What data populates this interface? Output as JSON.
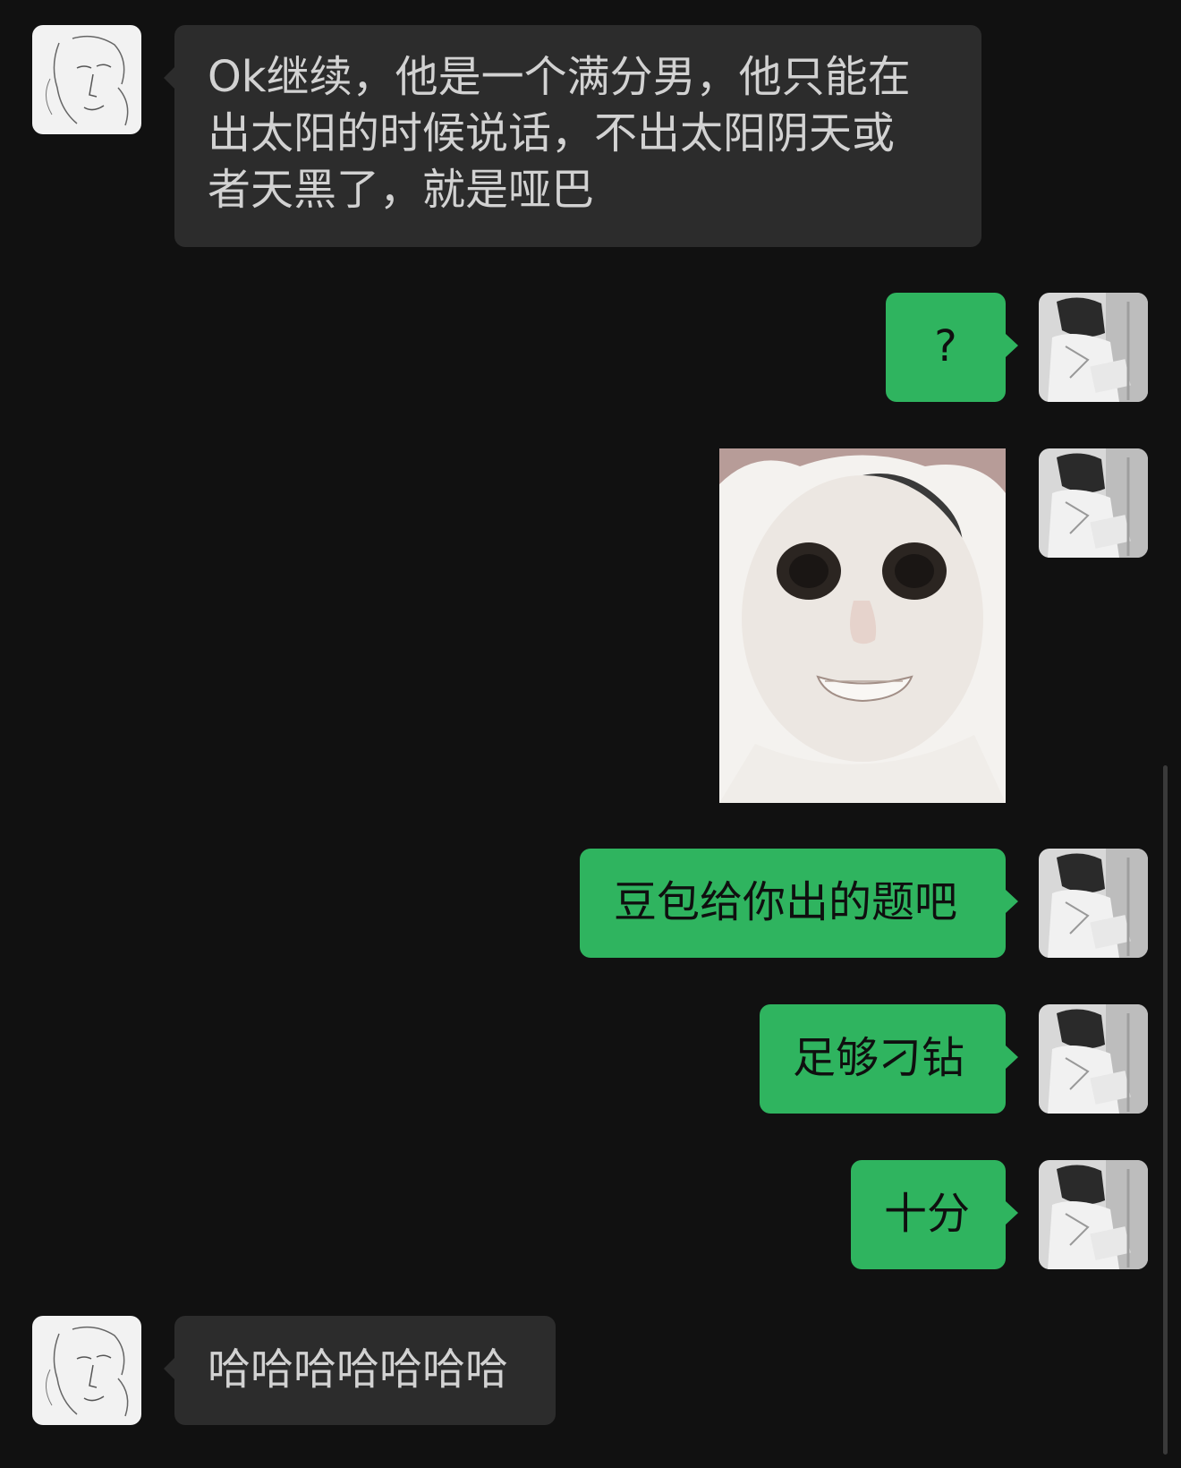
{
  "messages": [
    {
      "sender": "other",
      "text": "Ok继续，他是一个满分男，他只能在\n出太阳的时候说话，不出太阳阴天或\n者天黑了，就是哑巴"
    },
    {
      "sender": "me",
      "text": "?"
    },
    {
      "sender": "me",
      "type": "sticker",
      "sticker": "cat-face-meme-icon"
    },
    {
      "sender": "me",
      "text": "豆包给你出的题吧"
    },
    {
      "sender": "me",
      "text": "足够刁钻"
    },
    {
      "sender": "me",
      "text": "十分"
    },
    {
      "sender": "other",
      "text": "哈哈哈哈哈哈哈"
    }
  ],
  "colors": {
    "background": "#111111",
    "incoming_bubble": "#2c2c2c",
    "outgoing_bubble": "#2fb45f"
  }
}
